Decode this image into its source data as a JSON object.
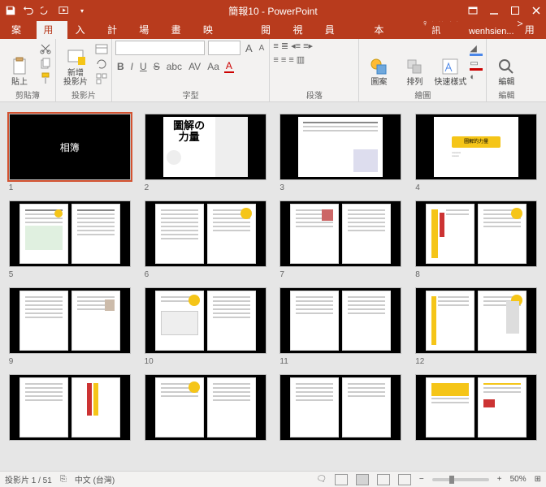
{
  "titlebar": {
    "document_title": "簡報10 - PowerPoint"
  },
  "tabs": {
    "file": "檔案",
    "home": "常用",
    "insert": "插入",
    "design": "設計",
    "transitions": "轉場",
    "animations": "動畫",
    "slideshow": "投影片放映",
    "review": "校閱",
    "view": "檢視",
    "developer": "開發人員",
    "storyboarding": "分鏡腳本",
    "tellme": "其他資訊",
    "user": "wenhsien...",
    "share": "共用"
  },
  "ribbon": {
    "clipboard_label": "剪貼簿",
    "paste": "貼上",
    "slides_label": "投影片",
    "newslide": "新增\n投影片",
    "font_label": "字型",
    "paragraph_label": "段落",
    "drawing_label": "繪圖",
    "shapes": "圖案",
    "arrange": "排列",
    "quickstyles": "快速樣式",
    "editing_label": "編輯",
    "editing": "編輯",
    "bold": "B",
    "italic": "I",
    "underline": "U",
    "strike": "S",
    "shadow": "abc",
    "charspace": "AV",
    "changecase": "Aa",
    "fontcolor": "A",
    "fontgrow": "A",
    "fontshrink": "A"
  },
  "slides": {
    "count": 16,
    "slide1_text": "相簿",
    "slide2_line1": "圖解の",
    "slide2_line2": "力量",
    "slide4_text": "圖解的力量"
  },
  "status": {
    "slide_indicator": "投影片 1 / 51",
    "language": "中文 (台灣)",
    "zoom": "50%"
  },
  "chart_data": null
}
